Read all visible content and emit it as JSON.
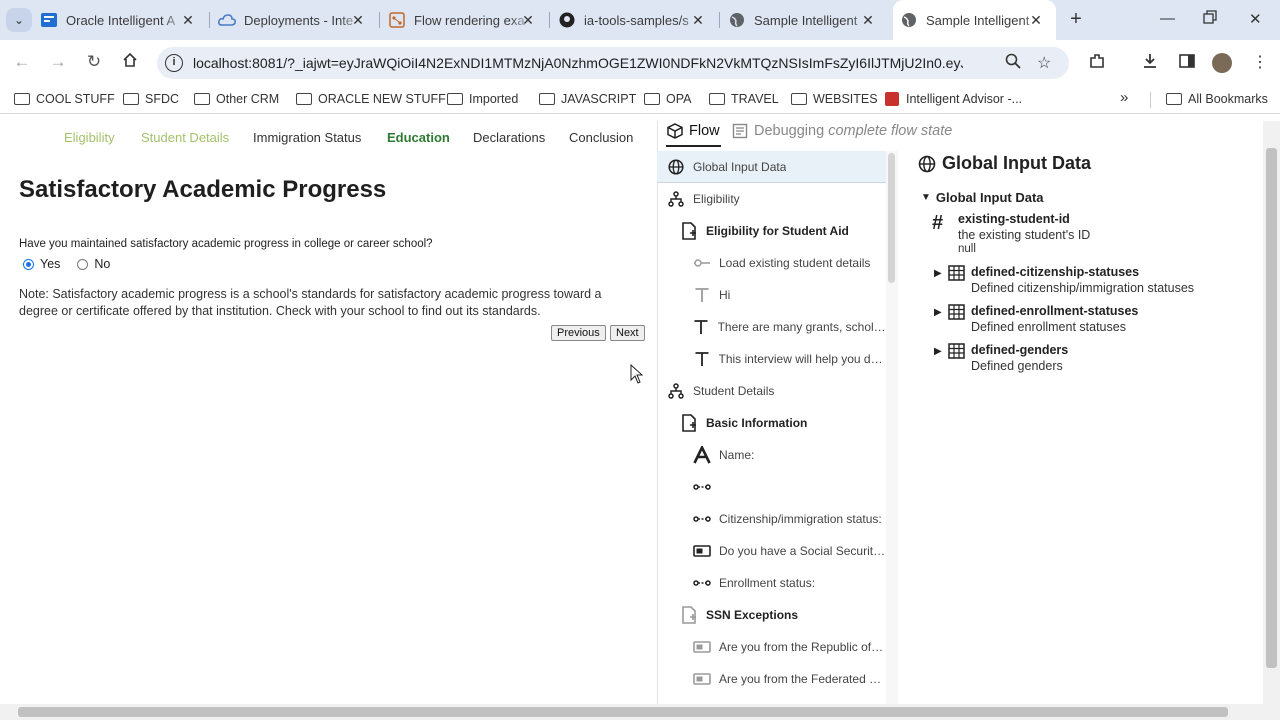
{
  "browser": {
    "tabs": [
      {
        "title": "Oracle Intelligent A",
        "icon": "oracle-grid-icon",
        "color": "#1f6fd0",
        "active": false
      },
      {
        "title": "Deployments - Inte",
        "icon": "cloud-icon",
        "color": "#4a7cc7",
        "active": false
      },
      {
        "title": "Flow rendering exa",
        "icon": "flow-icon",
        "color": "#c0692a",
        "active": false
      },
      {
        "title": "ia-tools-samples/s",
        "icon": "github-icon",
        "color": "#222222",
        "active": false
      },
      {
        "title": "Sample Intelligent",
        "icon": "globe-icon",
        "color": "#5f6368",
        "active": false
      },
      {
        "title": "Sample Intelligent",
        "icon": "globe-icon",
        "color": "#5f6368",
        "active": true
      }
    ],
    "url": "localhost:8081/?_iajwt=eyJraWQiOiI4N2ExNDI1MTMzNjA0NzhmOGE1ZWI0NDFkN2VkMTQzNSIsImFsZyI6IlJTMjU2In0.eyJzdWIiOi...",
    "bookmarks": [
      {
        "label": "COOL STUFF",
        "type": "folder"
      },
      {
        "label": "SFDC",
        "type": "folder"
      },
      {
        "label": "Other CRM",
        "type": "folder"
      },
      {
        "label": "ORACLE NEW STUFF",
        "type": "folder"
      },
      {
        "label": "Imported",
        "type": "folder"
      },
      {
        "label": "JAVASCRIPT",
        "type": "folder"
      },
      {
        "label": "OPA",
        "type": "folder"
      },
      {
        "label": "TRAVEL",
        "type": "folder"
      },
      {
        "label": "WEBSITES",
        "type": "folder"
      },
      {
        "label": "Intelligent Advisor -...",
        "type": "link"
      }
    ],
    "more_bookmarks": "»",
    "all_bookmarks": "All Bookmarks"
  },
  "interview": {
    "steps": [
      {
        "label": "Eligibility",
        "state": "done"
      },
      {
        "label": "Student Details",
        "state": "done"
      },
      {
        "label": "Immigration Status",
        "state": "todo"
      },
      {
        "label": "Education",
        "state": "current"
      },
      {
        "label": "Declarations",
        "state": "todo"
      },
      {
        "label": "Conclusion",
        "state": "todo"
      }
    ],
    "title": "Satisfactory Academic Progress",
    "question": "Have you maintained satisfactory academic progress in college or career school?",
    "options": [
      "Yes",
      "No"
    ],
    "selected": "Yes",
    "note": "Note: Satisfactory academic progress is a school's standards for satisfactory academic progress toward a degree or certificate offered by that institution. Check with your school to find out its standards.",
    "previous_label": "Previous",
    "next_label": "Next"
  },
  "flow_panel": {
    "tab_flow": "Flow",
    "tab_debug_prefix": "Debugging",
    "tab_debug_suffix": "complete flow state",
    "tree": [
      {
        "label": "Global Input Data",
        "icon": "globe-icon",
        "level": 0,
        "selected": true
      },
      {
        "label": "Eligibility",
        "icon": "hierarchy-icon",
        "level": 0
      },
      {
        "label": "Eligibility for Student Aid",
        "icon": "page-icon",
        "level": 1,
        "bold": true
      },
      {
        "label": "Load existing student details",
        "icon": "connector-icon",
        "level": 2,
        "dim": true
      },
      {
        "label": "Hi",
        "icon": "text-icon",
        "level": 2,
        "dim": true
      },
      {
        "label": "There are many grants, scholars...",
        "icon": "text-icon",
        "level": 2
      },
      {
        "label": "This interview will help you det...",
        "icon": "text-icon",
        "level": 2
      },
      {
        "label": "Student Details",
        "icon": "hierarchy-icon",
        "level": 0
      },
      {
        "label": "Basic Information",
        "icon": "page-icon",
        "level": 1,
        "bold": true
      },
      {
        "label": "Name:",
        "icon": "letter-a-icon",
        "level": 2
      },
      {
        "label": "",
        "icon": "dots-icon",
        "level": 2
      },
      {
        "label": "Citizenship/immigration status:",
        "icon": "dots-icon",
        "level": 2
      },
      {
        "label": "Do you have a Social Security N...",
        "icon": "input-box-icon",
        "level": 2
      },
      {
        "label": "Enrollment status:",
        "icon": "dots-icon",
        "level": 2
      },
      {
        "label": "SSN Exceptions",
        "icon": "page-icon",
        "level": 1,
        "bold": true,
        "dim_icon": true
      },
      {
        "label": "Are you from the Republic of th...",
        "icon": "input-box-icon",
        "level": 2,
        "dim_icon": true
      },
      {
        "label": "Are you from the Federated Sta...",
        "icon": "input-box-icon",
        "level": 2,
        "dim_icon": true
      }
    ]
  },
  "details": {
    "title": "Global Input Data",
    "section": "Global Input Data",
    "attributes": [
      {
        "name": "existing-student-id",
        "desc": "the existing student's ID",
        "value": "null",
        "icon": "hash-icon",
        "expandable": false
      },
      {
        "name": "defined-citizenship-statuses",
        "desc": "Defined citizenship/immigration statuses",
        "icon": "table-icon",
        "expandable": true
      },
      {
        "name": "defined-enrollment-statuses",
        "desc": "Defined enrollment statuses",
        "icon": "table-icon",
        "expandable": true
      },
      {
        "name": "defined-genders",
        "desc": "Defined genders",
        "icon": "table-icon",
        "expandable": true
      }
    ]
  }
}
